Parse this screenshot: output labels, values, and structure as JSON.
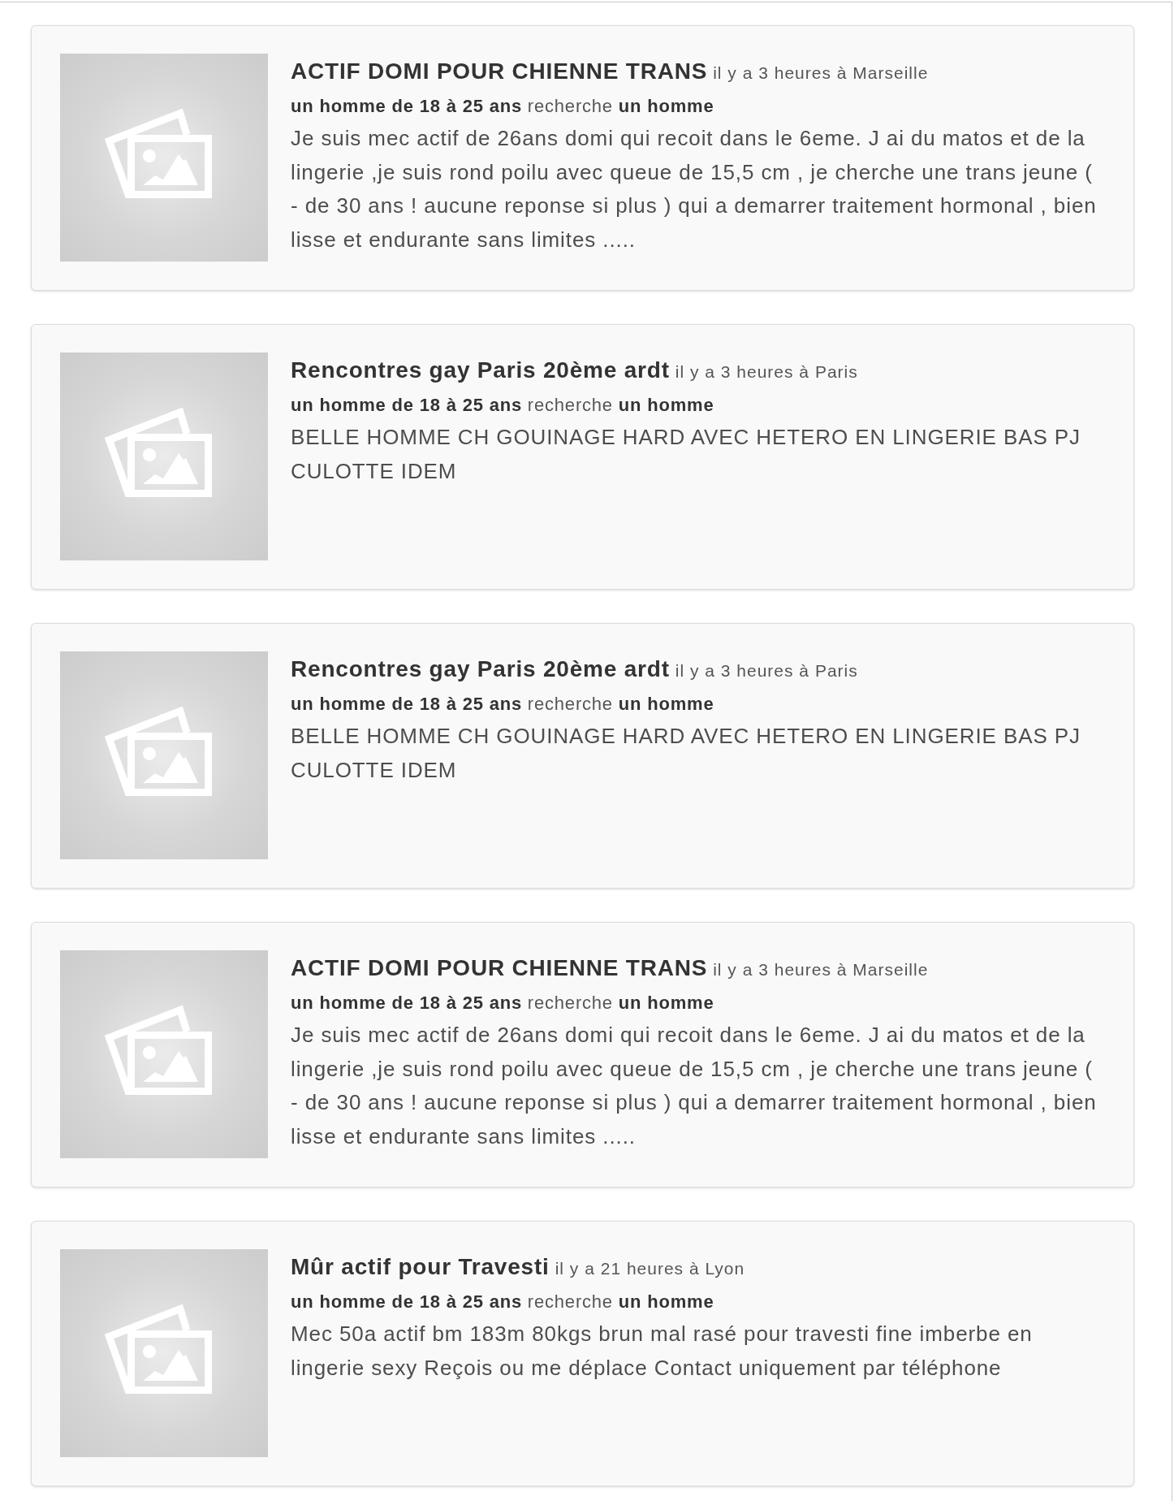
{
  "listings": [
    {
      "title": "ACTIF DOMI POUR CHIENNE TRANS",
      "meta": "il y a 3 heures à Marseille",
      "profile": "**un homme de 18 à 25 ans** recherche **un homme**",
      "description": "Je suis mec actif de 26ans domi qui recoit dans le 6eme. J ai du matos et de la lingerie ,je suis rond poilu avec queue de 15,5 cm , je cherche une trans jeune ( - de 30 ans ! aucune reponse si plus ) qui a demarrer traitement hormonal , bien lisse et endurante sans limites ....."
    },
    {
      "title": "Rencontres gay Paris 20ème ardt",
      "meta": "il y a 3 heures à Paris",
      "profile": "**un homme de 18 à 25 ans** recherche **un homme**",
      "description": "BELLE HOMME CH GOUINAGE HARD AVEC HETERO EN LINGERIE BAS PJ CULOTTE IDEM"
    },
    {
      "title": "Rencontres gay Paris 20ème ardt",
      "meta": "il y a 3 heures à Paris",
      "profile": "**un homme de 18 à 25 ans** recherche **un homme**",
      "description": "BELLE HOMME CH GOUINAGE HARD AVEC HETERO EN LINGERIE BAS PJ CULOTTE IDEM"
    },
    {
      "title": "ACTIF DOMI POUR CHIENNE TRANS",
      "meta": "il y a 3 heures à Marseille",
      "profile": "**un homme de 18 à 25 ans** recherche **un homme**",
      "description": "Je suis mec actif de 26ans domi qui recoit dans le 6eme. J ai du matos et de la lingerie ,je suis rond poilu avec queue de 15,5 cm , je cherche une trans jeune ( - de 30 ans ! aucune reponse si plus ) qui a demarrer traitement hormonal , bien lisse et endurante sans limites ....."
    },
    {
      "title": "Mûr actif pour Travesti",
      "meta": "il y a 21 heures à Lyon",
      "profile": "**un homme de 18 à 25 ans** recherche **un homme**",
      "description": "Mec 50a actif bm 183m 80kgs brun mal rasé pour travesti fine imberbe en lingerie sexy Reçois ou me déplace Contact uniquement par téléphone"
    }
  ]
}
